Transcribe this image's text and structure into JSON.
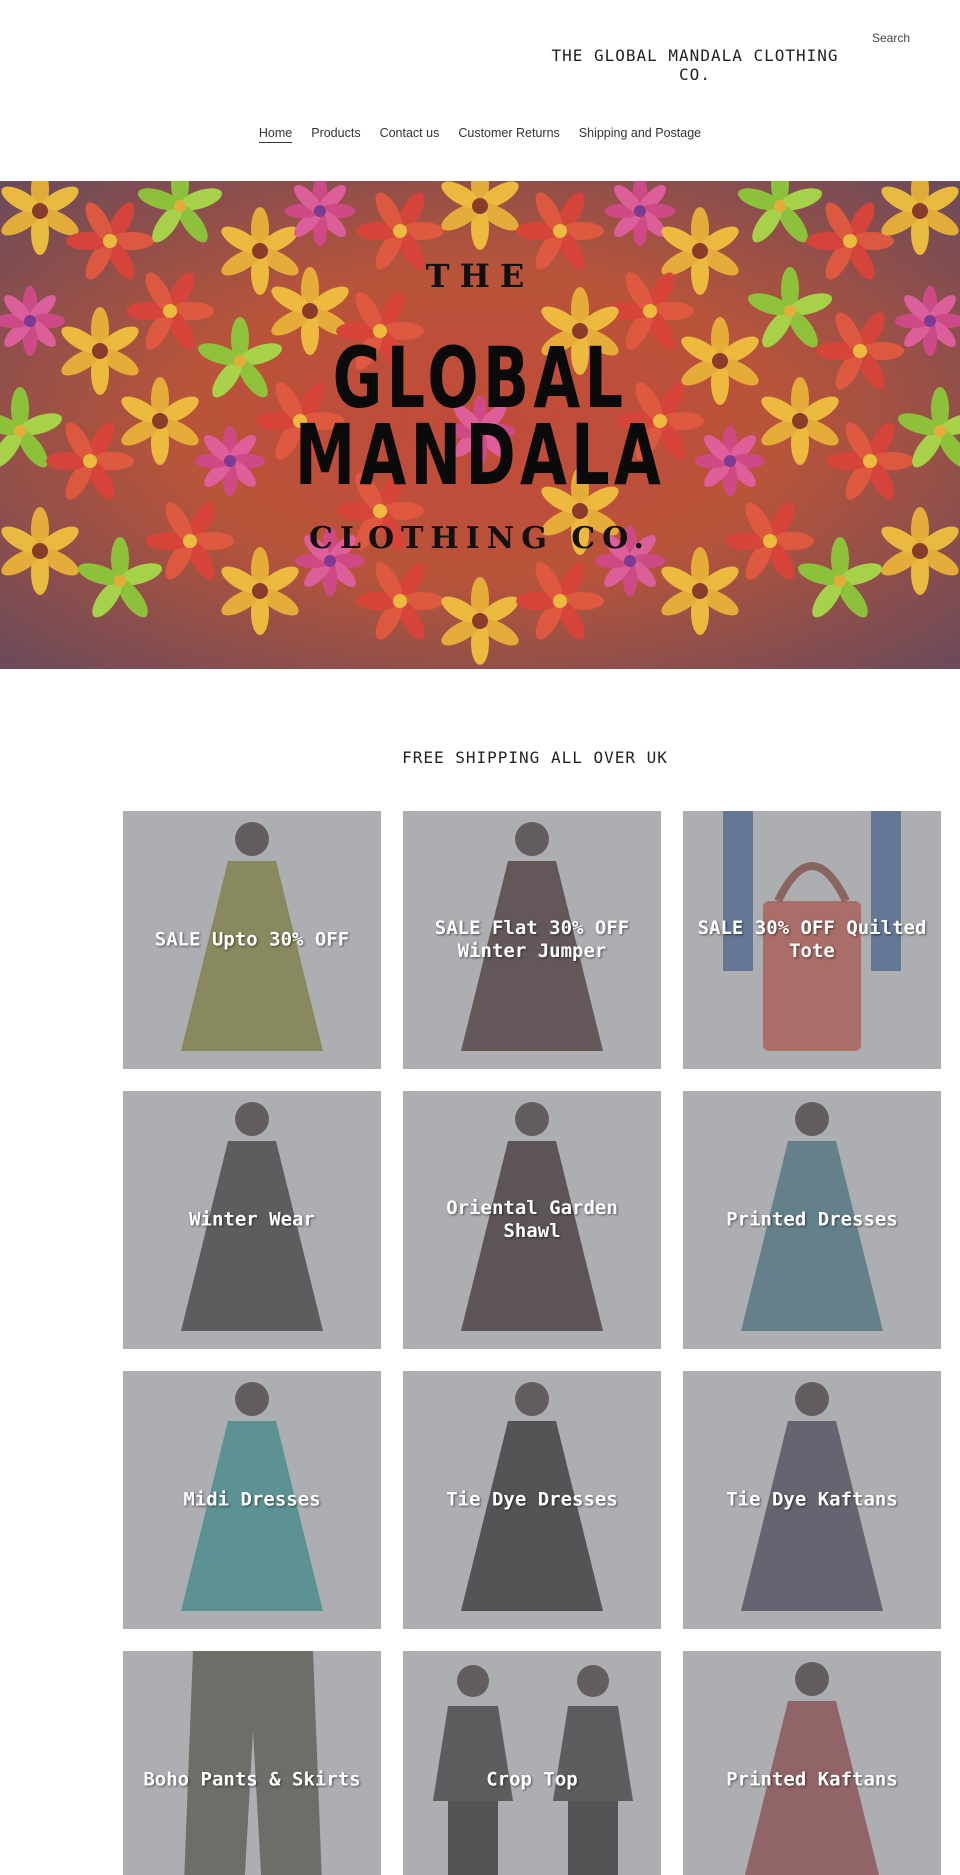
{
  "header": {
    "store_title": "THE GLOBAL MANDALA CLOTHING CO.",
    "search_label": "Search"
  },
  "nav": {
    "items": [
      {
        "label": "Home",
        "active": true
      },
      {
        "label": "Products"
      },
      {
        "label": "Contact us"
      },
      {
        "label": "Customer Returns"
      },
      {
        "label": "Shipping and Postage"
      }
    ]
  },
  "hero": {
    "line1": "THE",
    "line2": "GLOBAL",
    "line3": "MANDALA",
    "line4": "CLOTHING CO."
  },
  "banner": {
    "text": "FREE SHIPPING ALL OVER UK"
  },
  "collections": [
    {
      "label": "SALE Upto 30% OFF",
      "icon": "dress-image",
      "color": "#7a7a2a"
    },
    {
      "label": "SALE Flat 30% OFF Winter Jumper",
      "icon": "kaftan-image",
      "color": "#3a2020"
    },
    {
      "label": "SALE 30% OFF Quilted Tote",
      "icon": "tote-bag-image",
      "color": "#b44a3a"
    },
    {
      "label": "Winter Wear",
      "icon": "poncho-image",
      "color": "#2a2a2a"
    },
    {
      "label": "Oriental Garden Shawl",
      "icon": "shawl-image",
      "color": "#2a1a1a"
    },
    {
      "label": "Printed Dresses",
      "icon": "dress-image",
      "color": "#3a6a7a"
    },
    {
      "label": "Midi Dresses",
      "icon": "dress-image",
      "color": "#2a8a8a"
    },
    {
      "label": "Tie Dye Dresses",
      "icon": "dress-image",
      "color": "#1a1a1a"
    },
    {
      "label": "Tie Dye Kaftans",
      "icon": "kaftan-image",
      "color": "#3a3a4a"
    },
    {
      "label": "Boho Pants & Skirts",
      "icon": "pants-image",
      "color": "#4a4a3a"
    },
    {
      "label": "Crop Top",
      "icon": "top-image",
      "color": "#2a2a2a"
    },
    {
      "label": "Printed Kaftans",
      "icon": "kaftan-image",
      "color": "#8a3a3a"
    }
  ]
}
